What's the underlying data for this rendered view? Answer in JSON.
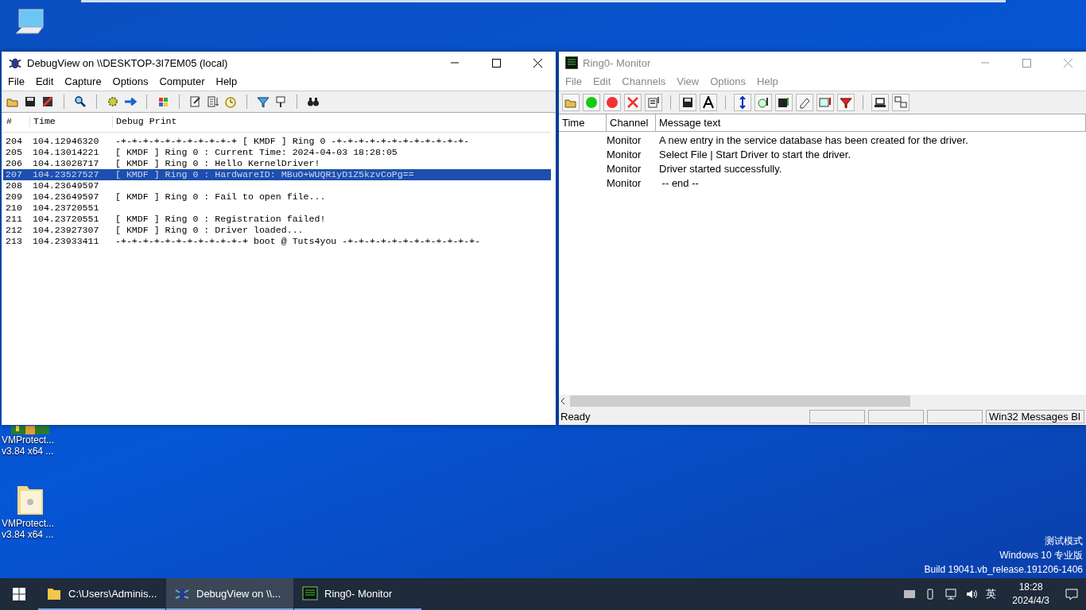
{
  "desktop_icons": [
    {
      "kind": "computer"
    },
    {
      "kind": "archive",
      "line1": "VMProtect...",
      "line2": "v3.84 x64 ..."
    },
    {
      "kind": "folder",
      "line1": "VMProtect...",
      "line2": "v3.84 x64 ..."
    }
  ],
  "debugview": {
    "title": "DebugView on \\\\DESKTOP-3I7EM05 (local)",
    "active": true,
    "menu": [
      "File",
      "Edit",
      "Capture",
      "Options",
      "Computer",
      "Help"
    ],
    "columns": [
      "#",
      "Time",
      "Debug Print"
    ],
    "rows": [
      {
        "index": "204",
        "time": "104.12946320",
        "text": "-+-+-+-+-+-+-+-+-+-+-+ [ KMDF ] Ring 0 -+-+-+-+-+-+-+-+-+-+-+-+-",
        "selected": false
      },
      {
        "index": "205",
        "time": "104.13014221",
        "text": "[ KMDF ] Ring 0 : Current Time: 2024-04-03 18:28:05",
        "selected": false
      },
      {
        "index": "206",
        "time": "104.13028717",
        "text": "[ KMDF ] Ring 0 : Hello KernelDriver!",
        "selected": false
      },
      {
        "index": "207",
        "time": "104.23527527",
        "text": "[ KMDF ] Ring 0 : HardwareID: MBuO+WUQR1yD1Z5kzvCoPg==",
        "selected": true
      },
      {
        "index": "208",
        "time": "104.23649597",
        "text": "",
        "selected": false
      },
      {
        "index": "209",
        "time": "104.23649597",
        "text": "[ KMDF ] Ring 0 : Fail to open file...",
        "selected": false
      },
      {
        "index": "210",
        "time": "104.23720551",
        "text": "",
        "selected": false
      },
      {
        "index": "211",
        "time": "104.23720551",
        "text": "[ KMDF ] Ring 0 : Registration failed!",
        "selected": false
      },
      {
        "index": "212",
        "time": "104.23927307",
        "text": "[ KMDF ] Ring 0 : Driver loaded...",
        "selected": false
      },
      {
        "index": "213",
        "time": "104.23933411",
        "text": "-+-+-+-+-+-+-+-+-+-+-+-+ boot @ Tuts4you -+-+-+-+-+-+-+-+-+-+-+-+-",
        "selected": false
      }
    ]
  },
  "monitor": {
    "title": "Ring0- Monitor",
    "active": false,
    "menu": [
      "File",
      "Edit",
      "Channels",
      "View",
      "Options",
      "Help"
    ],
    "columns": [
      "Time",
      "Channel",
      "Message text"
    ],
    "rows": [
      {
        "channel": "Monitor",
        "message": "A new entry in the service database has been created for the driver."
      },
      {
        "channel": "Monitor",
        "message": "Select File | Start Driver to start the driver."
      },
      {
        "channel": "Monitor",
        "message": "Driver started successfully."
      },
      {
        "channel": "Monitor",
        "message": " -- end --"
      }
    ],
    "status_bar": {
      "text": "Ready",
      "panes": [
        "Win32 Messages Bl"
      ]
    }
  },
  "os_notice": [
    "测试模式",
    "Windows 10 专业版",
    "Build 19041.vb_release.191206-1406"
  ],
  "taskbar": {
    "items": [
      {
        "kind": "folder",
        "label": "C:\\Users\\Adminis...",
        "selected": false
      },
      {
        "kind": "debugview",
        "label": "DebugView on \\\\...",
        "selected": true
      },
      {
        "kind": "monitor",
        "label": "Ring0- Monitor",
        "selected": false
      }
    ],
    "ime": "英",
    "time": "18:28",
    "date": "2024/4/3"
  }
}
